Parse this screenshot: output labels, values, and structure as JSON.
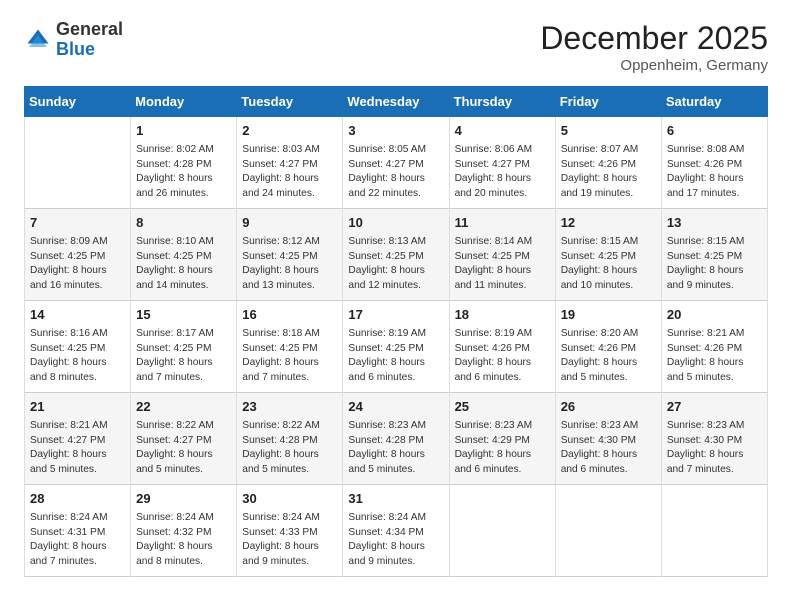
{
  "header": {
    "logo_general": "General",
    "logo_blue": "Blue",
    "month_title": "December 2025",
    "location": "Oppenheim, Germany"
  },
  "columns": [
    "Sunday",
    "Monday",
    "Tuesday",
    "Wednesday",
    "Thursday",
    "Friday",
    "Saturday"
  ],
  "rows": [
    [
      {
        "day": "",
        "content": ""
      },
      {
        "day": "1",
        "content": "Sunrise: 8:02 AM\nSunset: 4:28 PM\nDaylight: 8 hours\nand 26 minutes."
      },
      {
        "day": "2",
        "content": "Sunrise: 8:03 AM\nSunset: 4:27 PM\nDaylight: 8 hours\nand 24 minutes."
      },
      {
        "day": "3",
        "content": "Sunrise: 8:05 AM\nSunset: 4:27 PM\nDaylight: 8 hours\nand 22 minutes."
      },
      {
        "day": "4",
        "content": "Sunrise: 8:06 AM\nSunset: 4:27 PM\nDaylight: 8 hours\nand 20 minutes."
      },
      {
        "day": "5",
        "content": "Sunrise: 8:07 AM\nSunset: 4:26 PM\nDaylight: 8 hours\nand 19 minutes."
      },
      {
        "day": "6",
        "content": "Sunrise: 8:08 AM\nSunset: 4:26 PM\nDaylight: 8 hours\nand 17 minutes."
      }
    ],
    [
      {
        "day": "7",
        "content": "Sunrise: 8:09 AM\nSunset: 4:25 PM\nDaylight: 8 hours\nand 16 minutes."
      },
      {
        "day": "8",
        "content": "Sunrise: 8:10 AM\nSunset: 4:25 PM\nDaylight: 8 hours\nand 14 minutes."
      },
      {
        "day": "9",
        "content": "Sunrise: 8:12 AM\nSunset: 4:25 PM\nDaylight: 8 hours\nand 13 minutes."
      },
      {
        "day": "10",
        "content": "Sunrise: 8:13 AM\nSunset: 4:25 PM\nDaylight: 8 hours\nand 12 minutes."
      },
      {
        "day": "11",
        "content": "Sunrise: 8:14 AM\nSunset: 4:25 PM\nDaylight: 8 hours\nand 11 minutes."
      },
      {
        "day": "12",
        "content": "Sunrise: 8:15 AM\nSunset: 4:25 PM\nDaylight: 8 hours\nand 10 minutes."
      },
      {
        "day": "13",
        "content": "Sunrise: 8:15 AM\nSunset: 4:25 PM\nDaylight: 8 hours\nand 9 minutes."
      }
    ],
    [
      {
        "day": "14",
        "content": "Sunrise: 8:16 AM\nSunset: 4:25 PM\nDaylight: 8 hours\nand 8 minutes."
      },
      {
        "day": "15",
        "content": "Sunrise: 8:17 AM\nSunset: 4:25 PM\nDaylight: 8 hours\nand 7 minutes."
      },
      {
        "day": "16",
        "content": "Sunrise: 8:18 AM\nSunset: 4:25 PM\nDaylight: 8 hours\nand 7 minutes."
      },
      {
        "day": "17",
        "content": "Sunrise: 8:19 AM\nSunset: 4:25 PM\nDaylight: 8 hours\nand 6 minutes."
      },
      {
        "day": "18",
        "content": "Sunrise: 8:19 AM\nSunset: 4:26 PM\nDaylight: 8 hours\nand 6 minutes."
      },
      {
        "day": "19",
        "content": "Sunrise: 8:20 AM\nSunset: 4:26 PM\nDaylight: 8 hours\nand 5 minutes."
      },
      {
        "day": "20",
        "content": "Sunrise: 8:21 AM\nSunset: 4:26 PM\nDaylight: 8 hours\nand 5 minutes."
      }
    ],
    [
      {
        "day": "21",
        "content": "Sunrise: 8:21 AM\nSunset: 4:27 PM\nDaylight: 8 hours\nand 5 minutes."
      },
      {
        "day": "22",
        "content": "Sunrise: 8:22 AM\nSunset: 4:27 PM\nDaylight: 8 hours\nand 5 minutes."
      },
      {
        "day": "23",
        "content": "Sunrise: 8:22 AM\nSunset: 4:28 PM\nDaylight: 8 hours\nand 5 minutes."
      },
      {
        "day": "24",
        "content": "Sunrise: 8:23 AM\nSunset: 4:28 PM\nDaylight: 8 hours\nand 5 minutes."
      },
      {
        "day": "25",
        "content": "Sunrise: 8:23 AM\nSunset: 4:29 PM\nDaylight: 8 hours\nand 6 minutes."
      },
      {
        "day": "26",
        "content": "Sunrise: 8:23 AM\nSunset: 4:30 PM\nDaylight: 8 hours\nand 6 minutes."
      },
      {
        "day": "27",
        "content": "Sunrise: 8:23 AM\nSunset: 4:30 PM\nDaylight: 8 hours\nand 7 minutes."
      }
    ],
    [
      {
        "day": "28",
        "content": "Sunrise: 8:24 AM\nSunset: 4:31 PM\nDaylight: 8 hours\nand 7 minutes."
      },
      {
        "day": "29",
        "content": "Sunrise: 8:24 AM\nSunset: 4:32 PM\nDaylight: 8 hours\nand 8 minutes."
      },
      {
        "day": "30",
        "content": "Sunrise: 8:24 AM\nSunset: 4:33 PM\nDaylight: 8 hours\nand 9 minutes."
      },
      {
        "day": "31",
        "content": "Sunrise: 8:24 AM\nSunset: 4:34 PM\nDaylight: 8 hours\nand 9 minutes."
      },
      {
        "day": "",
        "content": ""
      },
      {
        "day": "",
        "content": ""
      },
      {
        "day": "",
        "content": ""
      }
    ]
  ]
}
